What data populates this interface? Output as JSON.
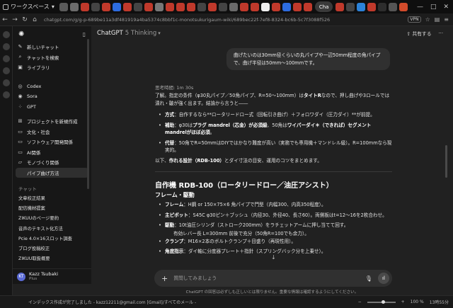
{
  "browser": {
    "workspace_label": "ワークスペース",
    "active_tab_label": "Cha",
    "url": "chatgpt.com/g/g-p-689be11a3df481919a4ba5374c8bbf1c-monotsukurigaum-wiki/689bec22f-7ef8-8324-bc6b-5c7f3088f526",
    "vpn_badge": "VPN",
    "tab_favicon_colors": [
      "#5a5a5a",
      "#6c6c6c",
      "#c0392b",
      "#444444",
      "#c0392b",
      "#2d6cdf",
      "#c0392b",
      "#444444",
      "#c0392b",
      "#777777",
      "#c0392b",
      "#c0392b",
      "#c0392b",
      "#444444",
      "#c0392b",
      "#444444",
      "#6a6a6a",
      "#c0392b",
      "#c0392b",
      "#f0f0f0",
      "#c0392b",
      "#2d6cdf",
      "#c0392b",
      "#c0392b"
    ],
    "tab_favicon_colors_right": [
      "#c0392b",
      "#444444",
      "#2b82d9",
      "#c0392b",
      "#2d2d2d",
      "#555555",
      "#d24b2b"
    ]
  },
  "sidebar": {
    "items_top": [
      {
        "icon": "edit-icon",
        "label": "新しいチャット"
      },
      {
        "icon": "search-icon",
        "label": "チャットを検索"
      },
      {
        "icon": "library-icon",
        "label": "ライブラリ"
      }
    ],
    "items_apps": [
      {
        "icon": "codex-icon",
        "label": "Codex"
      },
      {
        "icon": "sora-icon",
        "label": "Sora"
      },
      {
        "icon": "gpt-icon",
        "label": "GPT"
      }
    ],
    "projects": [
      {
        "icon": "folder-icon",
        "label": "プロジェクトを新規作成"
      },
      {
        "icon": "folder-icon",
        "label": "文化・社会"
      },
      {
        "icon": "folder-icon",
        "label": "ソフトウェア開発関係"
      },
      {
        "icon": "folder-icon",
        "label": "AI関係"
      },
      {
        "icon": "folder-icon",
        "label": "モノづくり関係"
      }
    ],
    "active_sub": "パイプ曲げ方法",
    "chats_heading": "チャット",
    "chats": [
      "文章校正結果",
      "配信機材提案",
      "ZIKUUのページ要約",
      "音声のテキスト化方法",
      "Pcie 4.0×16スロット調査",
      "ブログ投稿校正",
      "ZIKUU取扱概要"
    ],
    "user": {
      "initials": "KT",
      "name": "Kazz Tsubaki",
      "plan": "Plus"
    }
  },
  "main": {
    "title": "ChatGPT",
    "model": "5 Thinking",
    "share_label": "共有する",
    "user_message": "曲げたいのは30mm径くらいの丸パイプや一辺50mm程度の角パイプで、曲げ半径は50mm〜100mmです。",
    "thought_time": "思考時間: 1m 30s",
    "intro": {
      "prefix": "了解。指定の条件（φ30丸パイプ／50角パイプ、R=50〜100mm）は",
      "bold": "タイトR",
      "suffix": "なので、押し曲げや3ロールでは潰れ・皺が強く出ます。結論から言うと――"
    },
    "summary_bullets": [
      {
        "label": "方式",
        "text": "：自作するなら**ロータリードロー式（回転引き曲げ）＋フォロワダイ（圧力ダイ）**が前提。"
      },
      {
        "label": "補助",
        "text": "：φ30は",
        "bold2": "プラグ mandrel（芯金）が必須級",
        "text2": "、50角は",
        "bold3": "ワイパーダイ＊（できれば）セグメント mandrelがほぼ必須",
        "text3": "。"
      },
      {
        "label": "代替",
        "text": "：50角でR=50mmはDIYではかなり難度が高い（実務でも専用機＋マンドレル級）。R=100mmなら現実的。"
      }
    ],
    "closing": {
      "prefix": "以下、",
      "bold": "作れる設計（RDB-100）",
      "suffix": "とダイ寸法の目安、運用のコツをまとめます。"
    },
    "h2": "自作機 RDB-100（ロータリードロー／油圧アシスト）",
    "h3": "フレーム・駆動",
    "spec_bullets": [
      {
        "label": "フレーム",
        "text": "：H鋼 or 150×75×6 角パイプで門型（内幅300、内高350程度）。"
      },
      {
        "label": "主ピボット",
        "text": "：S45C φ30ピン＋ブッシュ（内径30、外径40、長さ60）。両側板はt=12〜16を2枚合わせ。"
      },
      {
        "label": "駆動",
        "text": "：10t油圧シリンダ（ストローク200mm）をラチェットアームに押し当てて回す。"
      }
    ],
    "sub_bullet": "有効レバー長 L=300mm 前後で充分（50角R=100でも余力）。",
    "more_bullets": [
      {
        "label": "クランプ",
        "text": "：M16×2本のボルトクランプ＋目盛り（再現性用）。"
      },
      {
        "label": "角度指示",
        "text": "：ダイ軸に分度器プレート＋指針（スプリングバック分を上乗せ）。"
      }
    ],
    "placeholder": "質問してみましょう",
    "disclaimer": "ChatGPT の回答は必ずしも正しいとは限りません。重要な情報は確認するようにしてください。"
  },
  "statusbar": {
    "left": "インデックス作成が完了しました - kazz12211@gmail.com [Gmail]/すべてのメール -",
    "zoom": "100 %",
    "time": "13時55分"
  }
}
